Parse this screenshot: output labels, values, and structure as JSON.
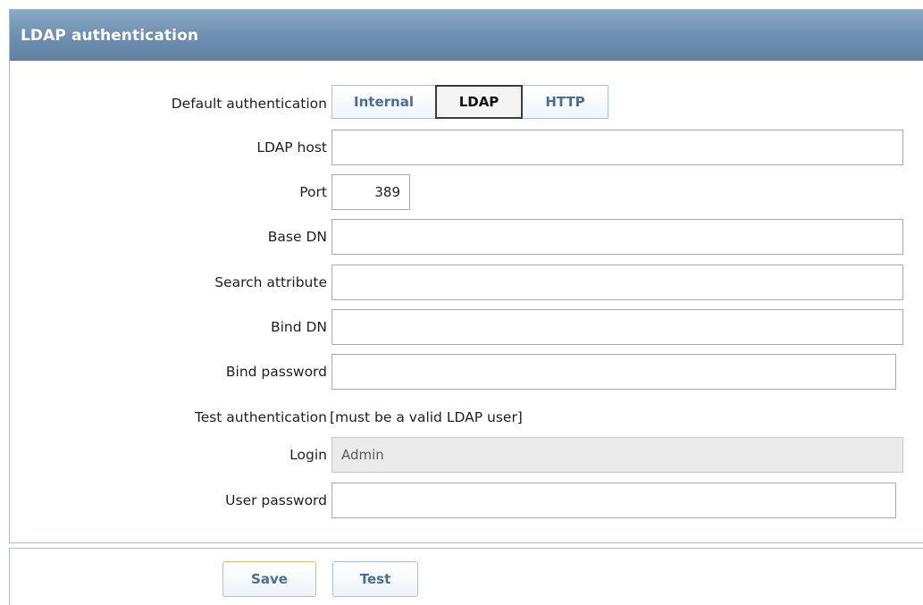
{
  "section": {
    "title": "LDAP authentication"
  },
  "default_authentication": {
    "label": "Default authentication",
    "options": [
      {
        "label": "Internal",
        "active": false
      },
      {
        "label": "LDAP",
        "active": true
      },
      {
        "label": "HTTP",
        "active": false
      }
    ]
  },
  "fields": {
    "ldap_host": {
      "label": "LDAP host",
      "value": ""
    },
    "port": {
      "label": "Port",
      "value": "389"
    },
    "base_dn": {
      "label": "Base DN",
      "value": ""
    },
    "search_attribute": {
      "label": "Search attribute",
      "value": ""
    },
    "bind_dn": {
      "label": "Bind DN",
      "value": ""
    },
    "bind_password": {
      "label": "Bind password",
      "value": ""
    },
    "test_authentication": {
      "label": "Test authentication",
      "note": "[must be a valid LDAP user]"
    },
    "login": {
      "label": "Login",
      "value": "Admin"
    },
    "user_password": {
      "label": "User password",
      "value": ""
    }
  },
  "buttons": {
    "save": "Save",
    "test": "Test"
  },
  "colors": {
    "header_bg": "#6f90b1",
    "save_border": "#f2b36b",
    "button_text": "#4a6f93"
  }
}
